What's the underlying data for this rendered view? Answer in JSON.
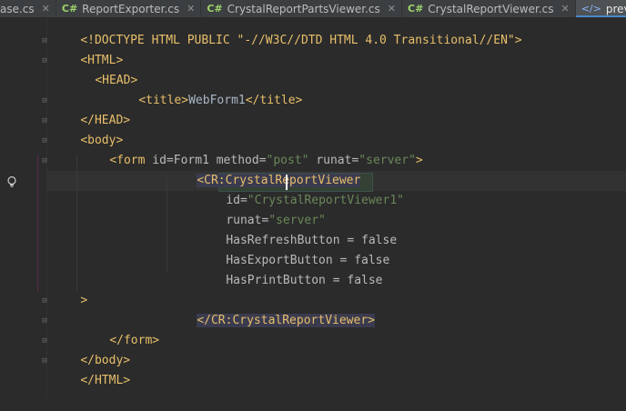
{
  "tabs": [
    {
      "label": "ase.cs",
      "icon": "none",
      "active": false
    },
    {
      "label": "ReportExporter.cs",
      "icon": "csharp-file-icon",
      "active": false
    },
    {
      "label": "CrystalReportPartsViewer.cs",
      "icon": "csharp-file-icon",
      "active": false
    },
    {
      "label": "CrystalReportViewer.cs",
      "icon": "csharp-file-icon",
      "active": false
    },
    {
      "label": "preview.aspx",
      "icon": "aspx-file-icon",
      "active": true
    }
  ],
  "code": {
    "line0": "<!DOCTYPE HTML PUBLIC \"-//W3C//DTD HTML 4.0 Transitional//EN\">",
    "line1_open": "<HTML>",
    "line2_open": "<HEAD>",
    "line3_title_open": "<title>",
    "line3_title_text": "WebForm1",
    "line3_title_close": "</title>",
    "line4_close": "</HEAD>",
    "line5_open": "<body>",
    "line6_form_tag": "<form",
    "line6_attr1": "id=Form1",
    "line6_attr2_name": "method=",
    "line6_attr2_val": "\"post\"",
    "line6_attr3_name": "runat=",
    "line6_attr3_val": "\"server\"",
    "line6_end": ">",
    "line7_tag": "<CR:CrystalReportViewer",
    "line8_name": "id=",
    "line8_val": "\"CrystalReportViewer1\"",
    "line9_name": "runat=",
    "line9_val": "\"server\"",
    "line10": "HasRefreshButton = false",
    "line11": "HasExportButton = false",
    "line12": "HasPrintButton = false",
    "line13": ">",
    "line14_close": "</CR:CrystalReportViewer>",
    "line15_close": "</form>",
    "line16_close": "</body>",
    "line17_close": "</HTML>"
  },
  "colors": {
    "background": "#2b2b2b",
    "tag": "#e8bf6a",
    "string": "#6a8759",
    "attribute": "#bababa",
    "accent": "#4a88c7"
  }
}
